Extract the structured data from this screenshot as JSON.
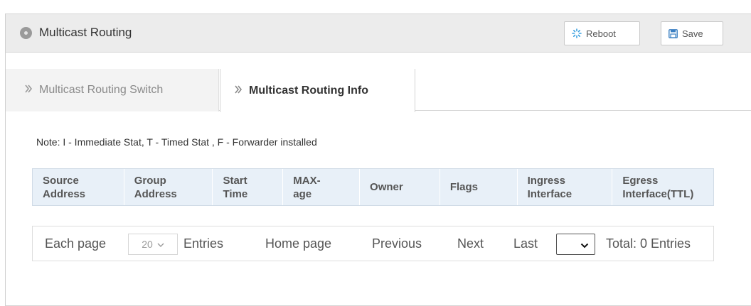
{
  "header": {
    "title": "Multicast Routing",
    "reboot_label": "Reboot",
    "save_label": "Save"
  },
  "tabs": [
    {
      "label": "Multicast Routing Switch",
      "active": false
    },
    {
      "label": "Multicast Routing Info",
      "active": true
    }
  ],
  "note": "Note: I - Immediate Stat, T - Timed Stat , F - Forwarder installed",
  "table": {
    "columns": [
      [
        "Source",
        "Address"
      ],
      [
        "Group",
        "Address"
      ],
      [
        "Start",
        "Time"
      ],
      [
        "MAX-",
        "age"
      ],
      [
        "Owner"
      ],
      [
        "Flags"
      ],
      [
        "Ingress",
        "Interface"
      ],
      [
        "Egress",
        "Interface(TTL)"
      ]
    ],
    "rows": []
  },
  "pager": {
    "each_page": "Each page",
    "page_size": "20",
    "entries": "Entries",
    "home": "Home page",
    "previous": "Previous",
    "next": "Next",
    "last": "Last",
    "total": "Total: 0 Entries"
  },
  "colors": {
    "header_bg": "#ececec",
    "table_header_bg": "#e8f0f8",
    "reboot_icon": "#3aa0e0",
    "save_icon": "#3a7fc2"
  },
  "icons": {
    "header": "status-dot-icon",
    "reboot": "spinner-icon",
    "save": "floppy-disk-icon",
    "tab": "chevron-right-icon",
    "select": "chevron-down-icon"
  }
}
